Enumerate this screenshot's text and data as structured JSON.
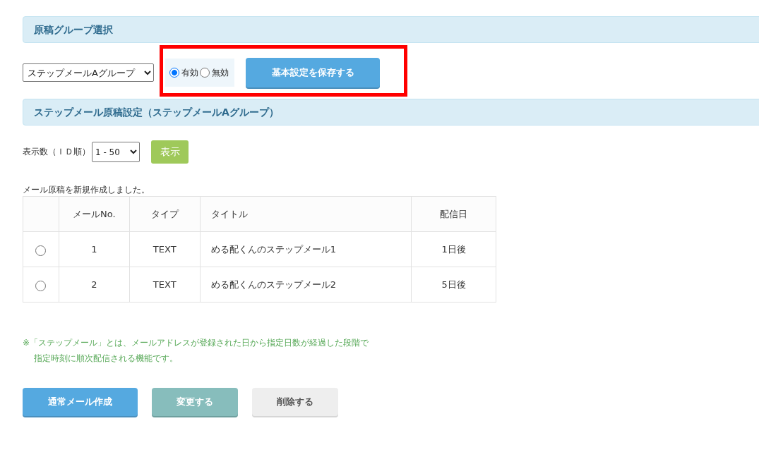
{
  "group_section": {
    "title": "原稿グループ選択",
    "group_select": {
      "value": "ステップメールAグループ"
    },
    "highlighted": true,
    "status_options": [
      {
        "label": "有効",
        "selected": true
      },
      {
        "label": "無効",
        "selected": false
      }
    ],
    "save_button": "基本設定を保存する"
  },
  "mail_section": {
    "title": "ステップメール原稿設定（ステップメールAグループ）",
    "display_count": {
      "label": "表示数（ＩＤ順）",
      "value": "1 - 50"
    },
    "show_button": "表示",
    "message": "メール原稿を新規作成しました。",
    "table": {
      "columns": [
        "メールNo.",
        "タイプ",
        "タイトル",
        "配信日"
      ],
      "rows": [
        {
          "selected": false,
          "cells": [
            "1",
            "TEXT",
            "める配くんのステップメール1",
            "1日後"
          ]
        },
        {
          "selected": false,
          "cells": [
            "2",
            "TEXT",
            "める配くんのステップメール2",
            "5日後"
          ]
        }
      ]
    }
  },
  "note": {
    "lines": [
      "※「ステップメール」とは、メールアドレスが登録された日から指定日数が経過した段階で",
      "指定時刻に順次配信される機能です。"
    ]
  },
  "buttons": [
    {
      "label": "通常メール作成",
      "kind": "primary"
    },
    {
      "label": "変更する",
      "kind": "secondary"
    },
    {
      "label": "削除する",
      "kind": "neutral"
    }
  ]
}
